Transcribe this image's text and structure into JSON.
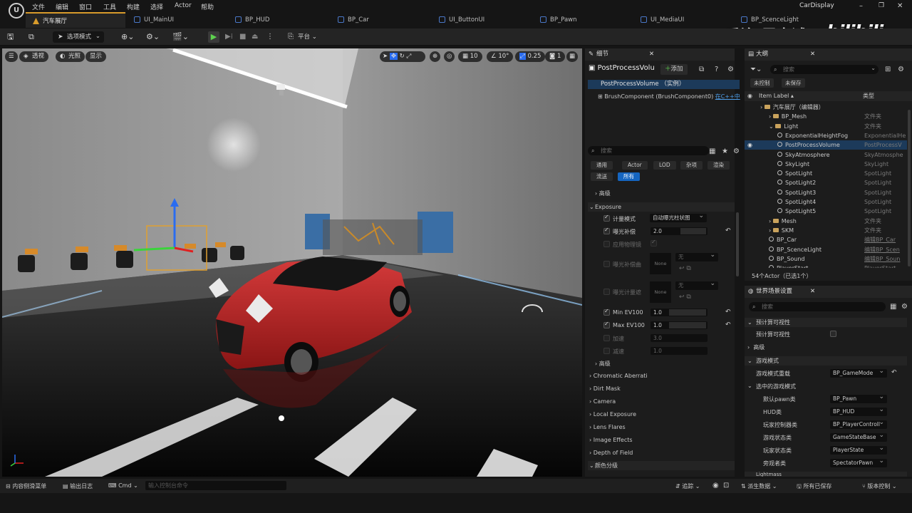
{
  "app": {
    "project_name": "CarDisplay"
  },
  "menu": [
    "文件",
    "编辑",
    "窗口",
    "工具",
    "构建",
    "选择",
    "Actor",
    "帮助"
  ],
  "tabs": [
    {
      "label": "汽车展厅",
      "active": true,
      "color": "#d89b2b"
    },
    {
      "label": "UI_MainUI",
      "active": false,
      "color": "#4a78c8"
    },
    {
      "label": "BP_HUD",
      "active": false,
      "color": "#4a78c8"
    },
    {
      "label": "BP_Car",
      "active": false,
      "color": "#4a78c8"
    },
    {
      "label": "UI_ButtonUI",
      "active": false,
      "color": "#4a78c8"
    },
    {
      "label": "BP_Pawn",
      "active": false,
      "color": "#4a78c8"
    },
    {
      "label": "UI_MediaUI",
      "active": false,
      "color": "#4a78c8"
    },
    {
      "label": "BP_ScenceLight",
      "active": false,
      "color": "#4a78c8"
    }
  ],
  "watermark": {
    "author": "乔治-周士诚",
    "brand": "bilibili"
  },
  "toolbar": {
    "mode": "选项模式",
    "platform": "平台"
  },
  "viewport": {
    "perspective": "透视",
    "lit": "光照",
    "show": "显示",
    "grid_size": "10",
    "rotate_snap": "10°",
    "scale_snap": "0.25",
    "camera_speed": "1"
  },
  "details": {
    "title": "细节",
    "selected_actor": "PostProcessVolu",
    "add_label": "添加",
    "instance_label": "PostProcessVolume （实例）",
    "component_label": "BrushComponent (BrushComponent0)",
    "component_link": "在C++中",
    "search_placeholder": "搜索",
    "filter_tabs": [
      "通用",
      "Actor",
      "LOD",
      "杂项",
      "渲染",
      "流送",
      "所有"
    ],
    "active_filter": "所有",
    "advanced": "高级",
    "exposure_header": "Exposure",
    "props": {
      "metering_mode": {
        "label": "计量模式",
        "value": "自动曝光柱状图"
      },
      "exposure_comp": {
        "label": "曝光补偿",
        "value": "2.0"
      },
      "apply_physical": {
        "label": "应用物理镜"
      },
      "exposure_curve": {
        "label": "曝光补偿曲",
        "value": "None",
        "dropdown": "无"
      },
      "meter_mask": {
        "label": "曝光计量遮",
        "value": "None",
        "dropdown": "无"
      },
      "min_ev": {
        "label": "Min EV100",
        "value": "1.0"
      },
      "max_ev": {
        "label": "Max EV100",
        "value": "1.0"
      },
      "speed_up": {
        "label": "加速",
        "value": "3.0"
      },
      "speed_down": {
        "label": "减速",
        "value": "1.0"
      }
    },
    "advanced2": "高级",
    "sections": [
      "Chromatic Aberrati",
      "Dirt Mask",
      "Camera",
      "Local Exposure",
      "Lens Flares",
      "Image Effects",
      "Depth of Field",
      "颜色分级"
    ]
  },
  "outliner": {
    "title": "大纲",
    "search_placeholder": "搜索",
    "unsaved": "未控制",
    "unsaved2": "未保存",
    "col_label": "Item Label",
    "col_type": "类型",
    "items": [
      {
        "label": "汽车展厅（编辑器）",
        "type": "",
        "indent": 0,
        "icon": "folder"
      },
      {
        "label": "BP_Mesh",
        "type": "文件夹",
        "indent": 1,
        "icon": "folder"
      },
      {
        "label": "Light",
        "type": "文件夹",
        "indent": 1,
        "icon": "folder"
      },
      {
        "label": "ExponentialHeightFog",
        "type": "ExponentialHe",
        "indent": 2,
        "icon": "light"
      },
      {
        "label": "PostProcessVolume",
        "type": "PostProcessV",
        "indent": 2,
        "icon": "light",
        "selected": true
      },
      {
        "label": "SkyAtmosphere",
        "type": "SkyAtmosphe",
        "indent": 2,
        "icon": "light"
      },
      {
        "label": "SkyLight",
        "type": "SkyLight",
        "indent": 2,
        "icon": "light"
      },
      {
        "label": "SpotLight",
        "type": "SpotLight",
        "indent": 2,
        "icon": "light"
      },
      {
        "label": "SpotLight2",
        "type": "SpotLight",
        "indent": 2,
        "icon": "light"
      },
      {
        "label": "SpotLight3",
        "type": "SpotLight",
        "indent": 2,
        "icon": "light"
      },
      {
        "label": "SpotLight4",
        "type": "SpotLight",
        "indent": 2,
        "icon": "light"
      },
      {
        "label": "SpotLight5",
        "type": "SpotLight",
        "indent": 2,
        "icon": "light"
      },
      {
        "label": "Mesh",
        "type": "文件夹",
        "indent": 1,
        "icon": "folder"
      },
      {
        "label": "SKM",
        "type": "文件夹",
        "indent": 1,
        "icon": "folder"
      },
      {
        "label": "BP_Car",
        "type": "编辑BP_Car",
        "indent": 1,
        "icon": "light",
        "link": true
      },
      {
        "label": "BP_ScenceLight",
        "type": "编辑BP_Scen",
        "indent": 1,
        "icon": "light",
        "link": true
      },
      {
        "label": "BP_Sound",
        "type": "编辑BP_Soun",
        "indent": 1,
        "icon": "light",
        "link": true
      },
      {
        "label": "PlayerStart",
        "type": "PlayerStart",
        "indent": 1,
        "icon": "light"
      }
    ],
    "footer": "54个Actor（已选1个）"
  },
  "world": {
    "title": "世界场景设置",
    "search_placeholder": "搜索",
    "rows": [
      {
        "label": "预计算可视性",
        "kind": "section"
      },
      {
        "label": "预计算可视性",
        "kind": "checkbox"
      },
      {
        "label": "高级",
        "kind": "section-collapsed"
      },
      {
        "label": "游戏模式",
        "kind": "section"
      },
      {
        "label": "游戏模式重载",
        "kind": "dropdown",
        "value": "BP_GameMode"
      },
      {
        "label": "选中的游戏模式",
        "kind": "subsection"
      },
      {
        "label": "默认pawn类",
        "kind": "dropdown",
        "value": "BP_Pawn"
      },
      {
        "label": "HUD类",
        "kind": "dropdown",
        "value": "BP_HUD"
      },
      {
        "label": "玩家控制器类",
        "kind": "dropdown",
        "value": "BP_PlayerControll"
      },
      {
        "label": "游戏状态类",
        "kind": "dropdown",
        "value": "GameStateBase"
      },
      {
        "label": "玩家状态类",
        "kind": "dropdown",
        "value": "PlayerState"
      },
      {
        "label": "旁观者类",
        "kind": "dropdown",
        "value": "SpectatorPawn"
      },
      {
        "label": "Lightmass",
        "kind": "section"
      }
    ]
  },
  "statusbar": {
    "content_drawer": "内容侧滑菜单",
    "output_log": "输出日志",
    "cmd": "Cmd",
    "console_placeholder": "输入控制台命令",
    "trace": "追踪",
    "derived_data": "派生数据",
    "all_saved": "所有已保存",
    "source_control": "版本控制"
  }
}
